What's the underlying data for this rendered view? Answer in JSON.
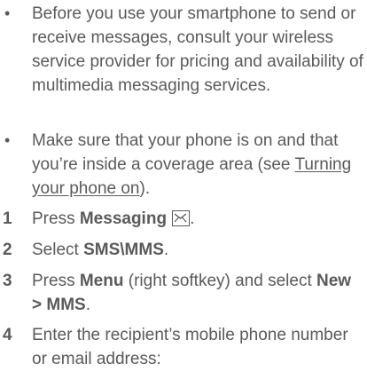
{
  "bullets": [
    {
      "marker": "•",
      "text": "Before you use your smartphone to send or receive messages, consult your wireless service provider for pricing and availability of multimedia messaging services."
    },
    {
      "marker": "•",
      "text_before_link": "Make sure that your phone is on and that you’re inside a coverage area (see ",
      "link": "Turning your phone on",
      "text_after_link": ")."
    }
  ],
  "steps": [
    {
      "number": "1",
      "pre": "Press ",
      "bold": "Messaging",
      "icon": "envelope-icon",
      "post": "."
    },
    {
      "number": "2",
      "pre": "Select ",
      "bold": "SMS\\MMS",
      "post": "."
    },
    {
      "number": "3",
      "pre": "Press ",
      "bold": "Menu",
      "mid": " (right softkey) and select ",
      "bold2": "New > MMS",
      "post": "."
    },
    {
      "number": "4",
      "text": "Enter the recipient’s mobile phone number or email address:"
    }
  ]
}
